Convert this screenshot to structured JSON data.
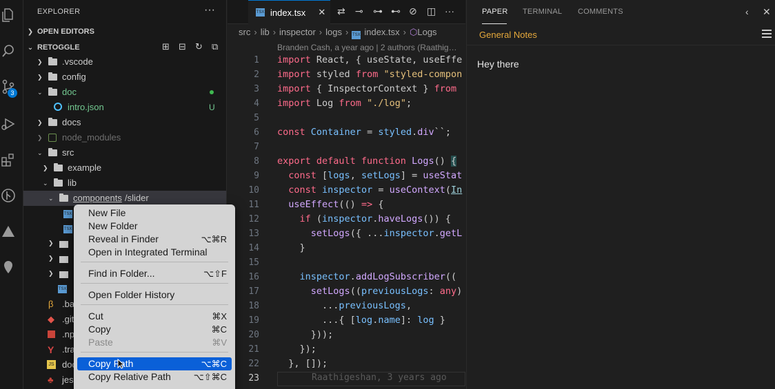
{
  "activity_bar": {
    "items": [
      {
        "icon": "files-icon"
      },
      {
        "icon": "search-icon"
      },
      {
        "icon": "source-control-icon",
        "badge": "3"
      },
      {
        "icon": "run-debug-icon"
      },
      {
        "icon": "extensions-icon"
      },
      {
        "icon": "git-graph-icon"
      },
      {
        "icon": "triangle-icon"
      },
      {
        "icon": "map-pin-icon"
      }
    ]
  },
  "sidebar": {
    "title": "EXPLORER",
    "more": "···",
    "open_editors": "OPEN EDITORS",
    "project": "RETOGGLE",
    "tree": [
      {
        "label": ".vscode"
      },
      {
        "label": "config"
      },
      {
        "label": "doc",
        "status": "modified"
      },
      {
        "label": "intro.json",
        "status": "U"
      },
      {
        "label": "docs"
      },
      {
        "label": "node_modules"
      },
      {
        "label": "src"
      },
      {
        "label": "example"
      },
      {
        "label": "lib"
      },
      {
        "label_a": "components",
        "label_b": "/slider"
      },
      {
        "label": ".ba"
      },
      {
        "label": ".git"
      },
      {
        "label": ".np"
      },
      {
        "label": ".tra"
      },
      {
        "label": "doc"
      },
      {
        "label": "jes"
      }
    ]
  },
  "editor": {
    "tab": {
      "label": "index.tsx",
      "close": "✕"
    },
    "breadcrumb": [
      "src",
      "lib",
      "inspector",
      "logs",
      "index.tsx",
      "Logs"
    ],
    "blame": "Branden Cash, a year ago | 2 authors (Raathig…",
    "line_numbers": [
      "1",
      "2",
      "3",
      "4",
      "5",
      "6",
      "7",
      "8",
      "9",
      "10",
      "11",
      "12",
      "13",
      "14",
      "15",
      "16",
      "17",
      "18",
      "19",
      "20",
      "21",
      "22",
      "23"
    ],
    "current_line_blame": "Raathigeshan, 3 years ago"
  },
  "panel": {
    "tabs": [
      "PAPER",
      "TERMINAL",
      "COMMENTS"
    ],
    "title": "General Notes",
    "content": "Hey there"
  },
  "context_menu": {
    "items": [
      {
        "label": "New File",
        "shortcut": ""
      },
      {
        "label": "New Folder",
        "shortcut": ""
      },
      {
        "label": "Reveal in Finder",
        "shortcut": "⌥⌘R"
      },
      {
        "label": "Open in Integrated Terminal",
        "shortcut": ""
      },
      {
        "label": "Find in Folder...",
        "shortcut": "⌥⇧F"
      },
      {
        "label": "Open Folder History",
        "shortcut": ""
      },
      {
        "label": "Cut",
        "shortcut": "⌘X"
      },
      {
        "label": "Copy",
        "shortcut": "⌘C"
      },
      {
        "label": "Paste",
        "shortcut": "⌘V",
        "disabled": true
      },
      {
        "label": "Copy Path",
        "shortcut": "⌥⌘C",
        "highlighted": true
      },
      {
        "label": "Copy Relative Path",
        "shortcut": "⌥⇧⌘C"
      }
    ]
  },
  "colors": {
    "accent": "#0078d4",
    "menu_highlight": "#0a60d8",
    "panel_title": "#e5a83b",
    "git_added": "#73c991"
  }
}
